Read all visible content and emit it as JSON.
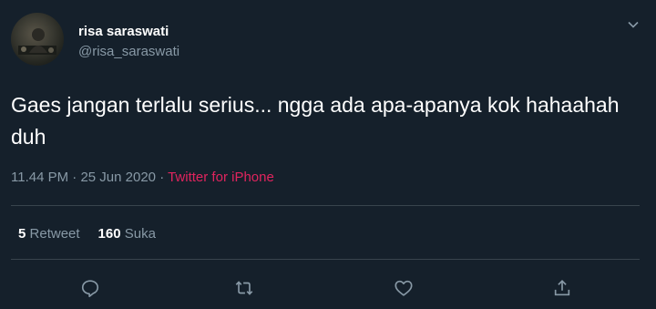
{
  "tweet": {
    "author_name": "risa saraswati",
    "author_handle": "@risa_saraswati",
    "text": "Gaes jangan terlalu serius... ngga ada apa-apanya kok hahaahah duh",
    "time": "11.44 PM",
    "date": "25 Jun 2020",
    "separator": "·",
    "source": "Twitter for iPhone",
    "retweet_count": "5",
    "retweet_label": "Retweet",
    "like_count": "160",
    "like_label": "Suka"
  },
  "icons": {
    "caret": "chevron-down-icon",
    "reply": "reply-icon",
    "retweet": "retweet-icon",
    "like": "like-icon",
    "share": "share-icon"
  },
  "colors": {
    "background": "#15202b",
    "secondary_text": "#8899a6",
    "source_link": "#e0245e",
    "divider": "#38444d"
  }
}
